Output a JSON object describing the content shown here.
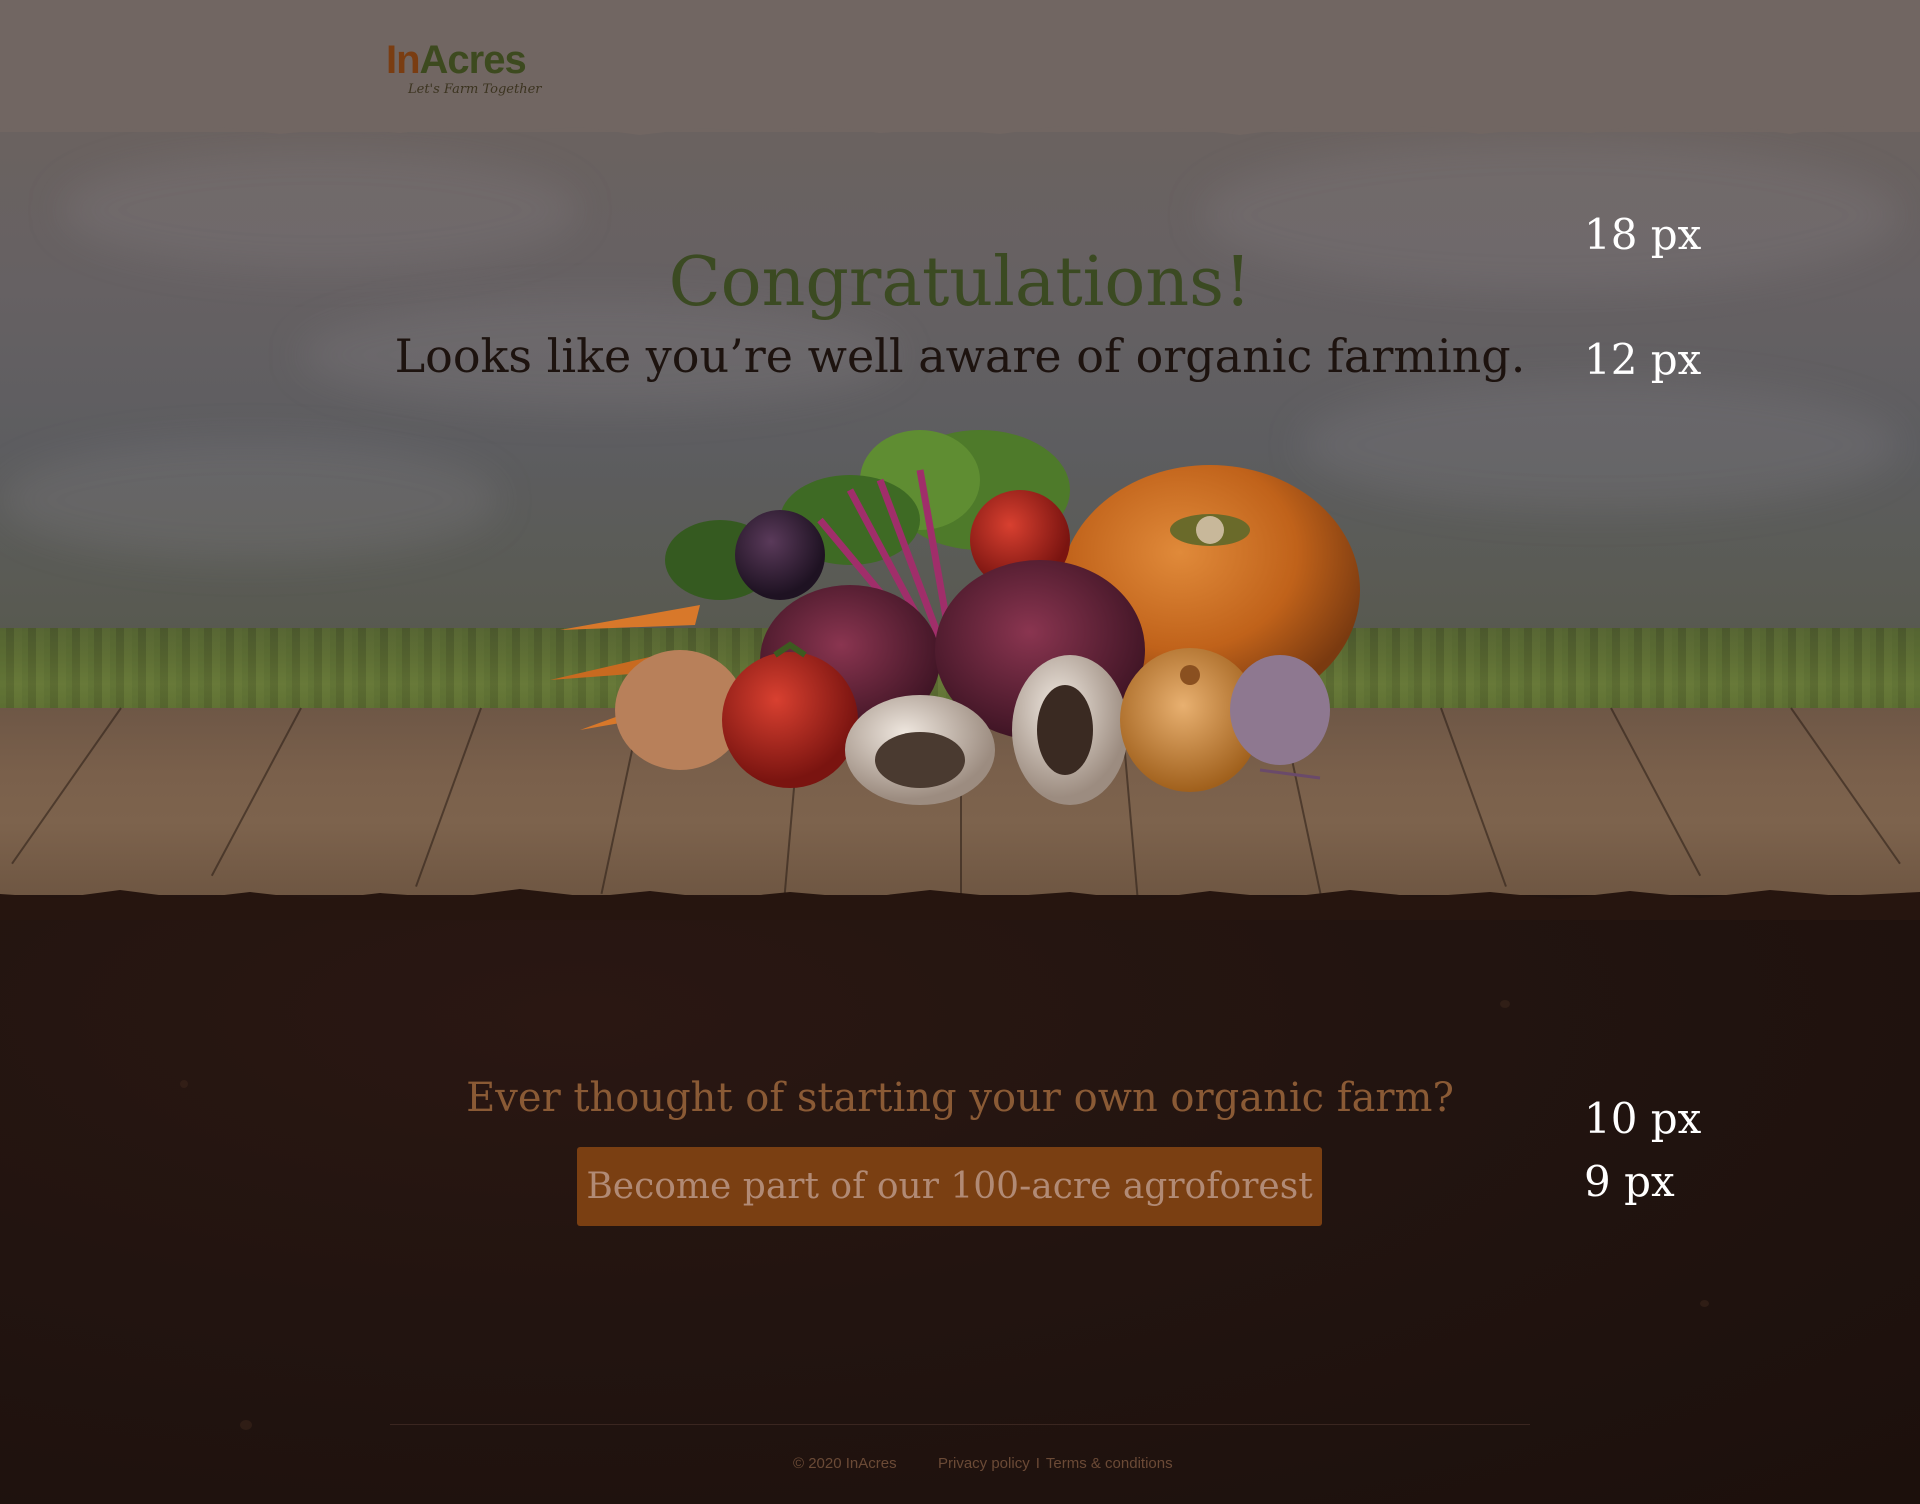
{
  "brand": {
    "name_part1": "In",
    "name_part2": "Acres",
    "tagline": "Let's Farm Together"
  },
  "hero": {
    "title": "Congratulations!",
    "subtitle": "Looks like you’re well aware of organic farming."
  },
  "specs": {
    "title_size": "18 px",
    "subtitle_size": "12 px",
    "question_size": "10 px",
    "button_size": "9 px"
  },
  "cta": {
    "question": "Ever thought of starting your own organic farm?",
    "button_label": "Become part of our 100-acre agroforest"
  },
  "footer": {
    "copyright": "© 2020 InAcres",
    "privacy": "Privacy policy",
    "separator": "I",
    "terms": "Terms & conditions"
  },
  "colors": {
    "title_green": "#3b4a22",
    "cta_orange": "#7a3f12",
    "soil": "#1e110d"
  }
}
